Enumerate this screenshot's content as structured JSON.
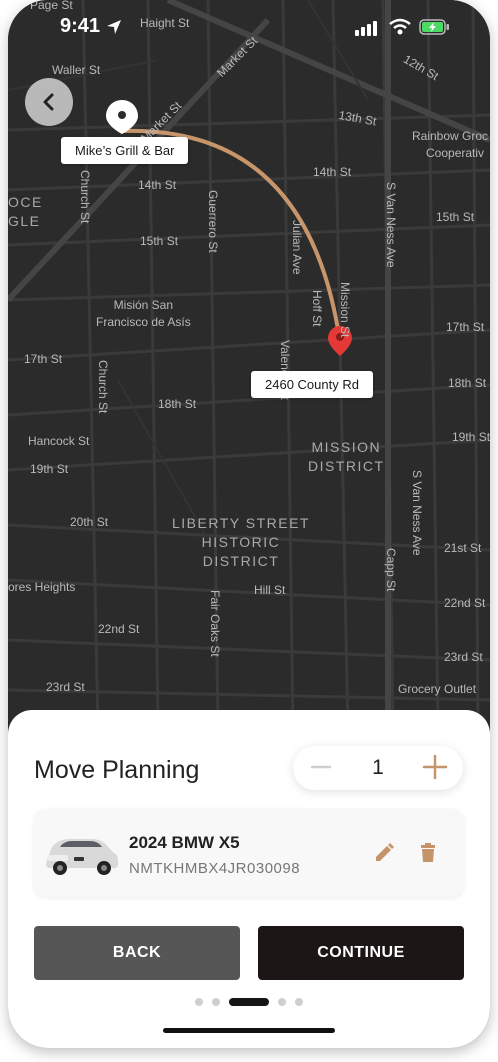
{
  "status_bar": {
    "time": "9:41"
  },
  "map": {
    "origin_label": "Mike’s Grill & Bar",
    "destination_label": "2460 County Rd",
    "streets": {
      "page": "Page St",
      "haight": "Haight St",
      "waller": "Waller St",
      "market1": "Market St",
      "market2": "Market St",
      "twelfth": "12th St",
      "thirteenth": "13th St",
      "rainbow": "Rainbow Groc",
      "cooperative": "Cooperativ",
      "church1": "Church St",
      "fourteenth1": "14th St",
      "fourteenth2": "14th St",
      "fifteenth1": "15th St",
      "fifteenth2": "15th St",
      "guerrero": "Guerrero St",
      "julian": "Julian Ave",
      "svanness1": "S Van Ness Ave",
      "hoff": "Hoff St",
      "mission": "Mission St",
      "seventeenth1": "17th St",
      "seventeenth2": "17th St",
      "church2": "Church St",
      "valencia": "Valencia St",
      "eighteenth1": "18th St",
      "eighteenth2": "18th St",
      "hancock": "Hancock St",
      "nineteenth1": "19th St",
      "nineteenth2": "19th St",
      "twentieth": "20th St",
      "svanness2": "S Van Ness Ave",
      "twentyfirst": "21st St",
      "capp": "Capp St",
      "hill": "Hill St",
      "dores": "ores Heights",
      "fairoaks": "Fair Oaks St",
      "twentysecond1": "22nd St",
      "twentysecond2": "22nd St",
      "twentythird1": "23rd St",
      "twentythird2": "23rd St",
      "grocery": "Grocery Outlet",
      "oce": "OCE",
      "gle": "GLE"
    },
    "places": {
      "mission_san_francisco": "Misión San\nFrancisco de Asís",
      "mission_district": "MISSION\nDISTRICT",
      "liberty": "LIBERTY STREET\nHISTORIC\nDISTRICT"
    }
  },
  "sheet": {
    "title": "Move Planning",
    "quantity": "1",
    "vehicle": {
      "name": "2024 BMW X5",
      "vin": "NMTKHMBX4JR030098"
    },
    "back_label": "BACK",
    "continue_label": "CONTINUE",
    "pager": {
      "total": 5,
      "active_index": 2
    }
  },
  "colors": {
    "accent": "#c6946a",
    "route": "#c8956a",
    "pin_destination": "#e53935",
    "continue_bg": "#1c1716",
    "back_bg": "#565656"
  }
}
